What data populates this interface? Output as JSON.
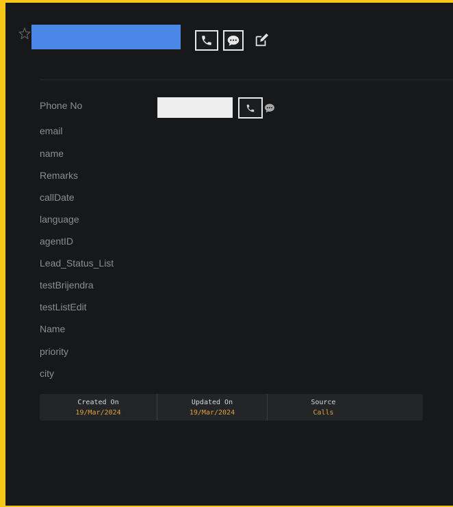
{
  "header": {
    "star_icon": "star-outline-icon",
    "call_icon": "phone-icon",
    "chat_icon": "chat-bubble-icon",
    "edit_icon": "edit-icon",
    "accent_color": "#f5c518",
    "name_placeholder_color": "#4a87e6"
  },
  "fields": {
    "phone_no": "Phone No",
    "email": "email",
    "name": "name",
    "remarks": "Remarks",
    "call_date": "callDate",
    "language": "language",
    "agent_id": "agentID",
    "lead_status_list": "Lead_Status_List",
    "test_brijendra": "testBrijendra",
    "test_list_edit": "testListEdit",
    "name_cap": "Name",
    "priority": "priority",
    "city": "city"
  },
  "meta": {
    "created_on_label": "Created On",
    "created_on_value": "19/Mar/2024",
    "updated_on_label": "Updated On",
    "updated_on_value": "19/Mar/2024",
    "source_label": "Source",
    "source_value": "Calls"
  }
}
